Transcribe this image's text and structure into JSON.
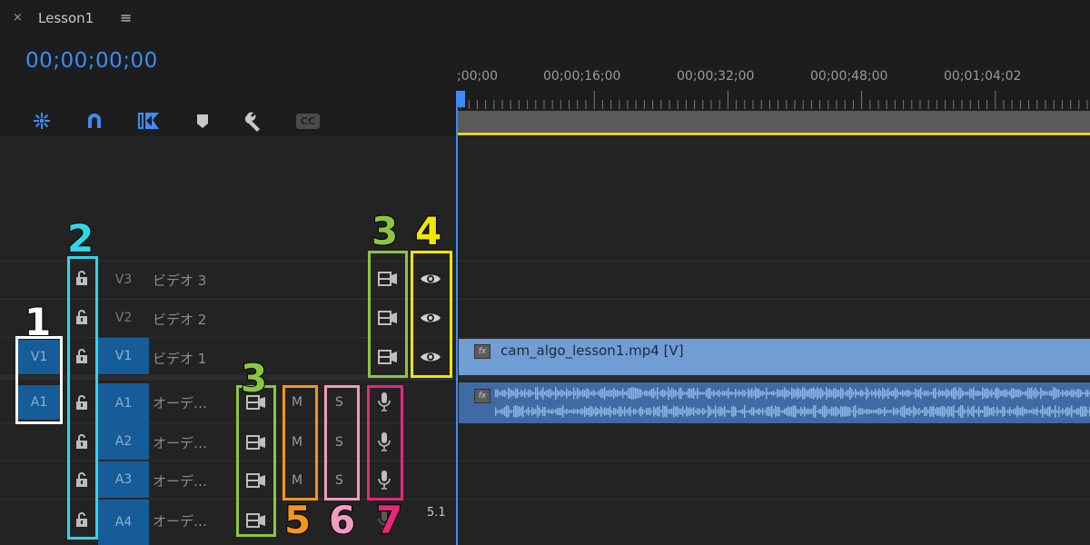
{
  "panel": {
    "close_glyph": "×",
    "title": "Lesson1",
    "menu_glyph": "≡",
    "timecode": "00;00;00;00"
  },
  "toolbar": {
    "tools": [
      "snap-nest-icon",
      "snap-magnet-icon",
      "linked-selection-icon",
      "add-marker-icon",
      "timeline-settings-wrench-icon",
      "captions-cc-icon"
    ],
    "cc_label": "CC"
  },
  "ruler": {
    "labels": [
      ";00;00",
      "00;00;16;00",
      "00;00;32;00",
      "00;00;48;00",
      "00;01;04;02"
    ]
  },
  "tracks": {
    "video": [
      {
        "id": "V3",
        "name": "ビデオ 3"
      },
      {
        "id": "V2",
        "name": "ビデオ 2"
      },
      {
        "id": "V1",
        "name": "ビデオ 1"
      }
    ],
    "audio": [
      {
        "id": "A1",
        "name": "オーデ…",
        "mute": "M",
        "solo": "S"
      },
      {
        "id": "A2",
        "name": "オーデ…",
        "mute": "M",
        "solo": "S"
      },
      {
        "id": "A3",
        "name": "オーデ…",
        "mute": "M",
        "solo": "S"
      },
      {
        "id": "A4",
        "name": "オーデ…",
        "mute": "",
        "solo": ""
      }
    ],
    "source_video": "V1",
    "source_audio": "A1",
    "a4_channel": "5.1"
  },
  "clips": {
    "video_clip": "cam_algo_lesson1.mp4 [V]",
    "fx_label": "fx"
  },
  "annotations": {
    "n1": "1",
    "n2": "2",
    "n3a": "3",
    "n3b": "3",
    "n4": "4",
    "n5": "5",
    "n6": "6",
    "n7": "7"
  },
  "colors": {
    "accent_blue": "#3d8cf5",
    "track_target_blue": "#155c99",
    "video_clip": "#6f9dd4",
    "audio_clip": "#3f6aa3",
    "annot_white": "#ffffff",
    "annot_cyan": "#2fd6e6",
    "annot_green": "#8cc63f",
    "annot_yellow": "#f2e600",
    "annot_orange": "#f7941d",
    "annot_pink": "#f49ac1",
    "annot_magenta": "#e6287a"
  }
}
